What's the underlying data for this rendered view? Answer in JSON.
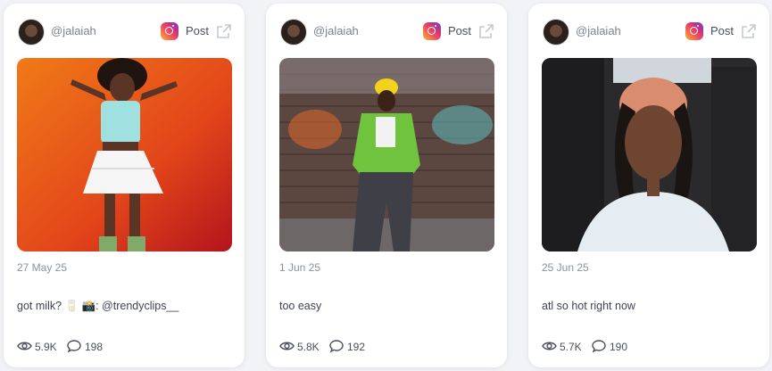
{
  "posts": [
    {
      "username": "@jalaiah",
      "platform_icon": "instagram-icon",
      "post_label": "Post",
      "date": "27 May 25",
      "caption": "got milk? 🥛 📸: @trendyclips__",
      "views": "5.9K",
      "comments": "198",
      "image_desc_colors": {
        "bg": "#ea5a12",
        "accent": "#c0392b"
      }
    },
    {
      "username": "@jalaiah",
      "platform_icon": "instagram-icon",
      "post_label": "Post",
      "date": "1 Jun 25",
      "caption": "too easy",
      "views": "5.8K",
      "comments": "192",
      "image_desc_colors": {
        "bg": "#5a4038",
        "accent": "#6bbf3a"
      }
    },
    {
      "username": "@jalaiah",
      "platform_icon": "instagram-icon",
      "post_label": "Post",
      "date": "25 Jun 25",
      "caption": "atl so hot right now",
      "views": "5.7K",
      "comments": "190",
      "image_desc_colors": {
        "bg": "#2b2b2e",
        "accent": "#d8e4ea"
      }
    }
  ]
}
